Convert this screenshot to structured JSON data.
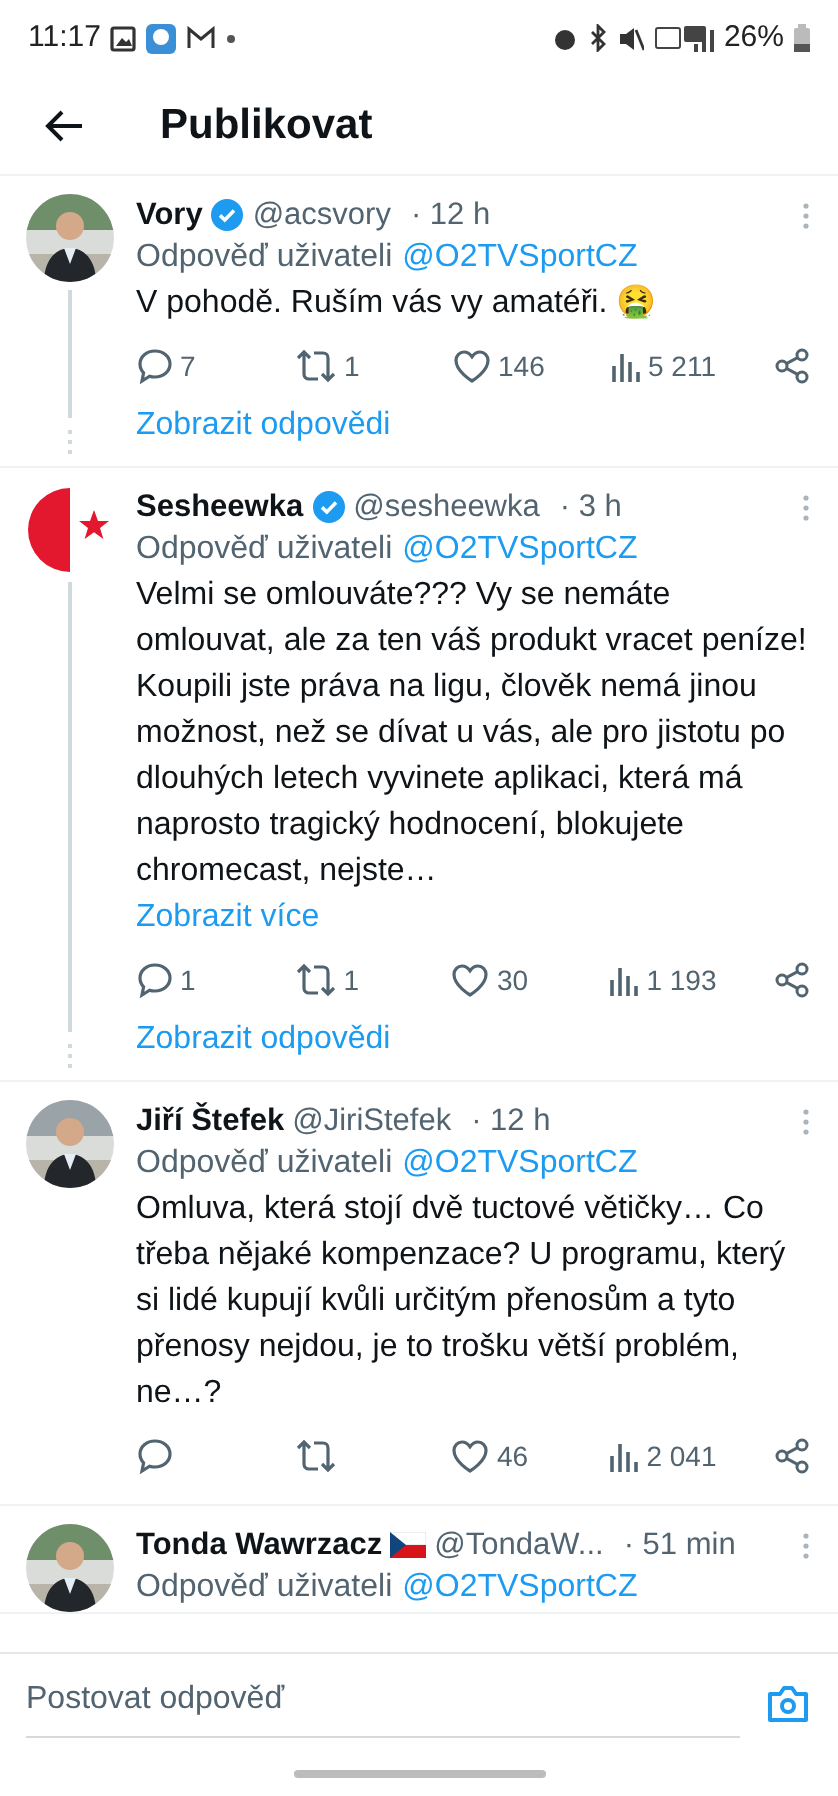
{
  "status_bar": {
    "time": "11:17",
    "battery": "26%"
  },
  "header": {
    "title": "Publikovat"
  },
  "tweets": [
    {
      "name": "Vory",
      "verified": true,
      "handle": "@acsvory",
      "time": "· 12 h",
      "reply_label": "Odpověď uživateli",
      "reply_to": "@O2TVSportCZ",
      "text": "V pohodě. Ruším vás vy amatéři. 🤮",
      "stats": [
        {
          "kind": "reply",
          "count": "7"
        },
        {
          "kind": "retweet",
          "count": "1"
        },
        {
          "kind": "like",
          "count": "146"
        },
        {
          "kind": "views",
          "count": "5 211"
        },
        {
          "kind": "share"
        }
      ],
      "thread_link": "Zobrazit odpovědi"
    },
    {
      "avatar": {
        "kind": "logo"
      },
      "name": "Sesheewka",
      "verified": true,
      "handle": "@sesheewka",
      "time": "· 3 h",
      "reply_label": "Odpověď uživateli",
      "reply_to": "@O2TVSportCZ",
      "text": "Velmi se omlouváte??? Vy se nemáte omlouvat, ale za ten váš produkt vracet peníze! Koupili jste práva na ligu, člověk nemá jinou možnost, než se dívat u vás, ale pro jistotu po dlouhých letech vyvinete aplikaci, která má naprosto tragický hodnocení, blokujete chromecast, nejste…",
      "show_more": "Zobrazit více",
      "stats": [
        {
          "kind": "reply",
          "count": "1"
        },
        {
          "kind": "retweet",
          "count": "1"
        },
        {
          "kind": "like",
          "count": "30"
        },
        {
          "kind": "views",
          "count": "1 193"
        },
        {
          "kind": "share"
        }
      ],
      "thread_link": "Zobrazit odpovědi"
    },
    {
      "name": "Jiří Štefek",
      "verified": false,
      "handle": "@JiriStefek",
      "time": "· 12 h",
      "reply_label": "Odpověď uživateli",
      "reply_to": "@O2TVSportCZ",
      "text": "Omluva, která stojí dvě tuctové větičky… Co třeba nějaké kompenzace? U programu, který si lidé kupují kvůli určitým přenosům a tyto přenosy nejdou, je to trošku větší problém, ne…?",
      "stats": [
        {
          "kind": "reply"
        },
        {
          "kind": "retweet"
        },
        {
          "kind": "like",
          "count": "46"
        },
        {
          "kind": "views",
          "count": "2 041"
        },
        {
          "kind": "share"
        }
      ]
    },
    {
      "name": "Tonda Wawrzacz",
      "verified": false,
      "flag": true,
      "handle": "@TondaW...",
      "time": "· 51 min",
      "reply_label": "Odpověď uživateli",
      "reply_to": "@O2TVSportCZ"
    }
  ],
  "reply_bar": {
    "placeholder": "Postovat odpověď"
  }
}
